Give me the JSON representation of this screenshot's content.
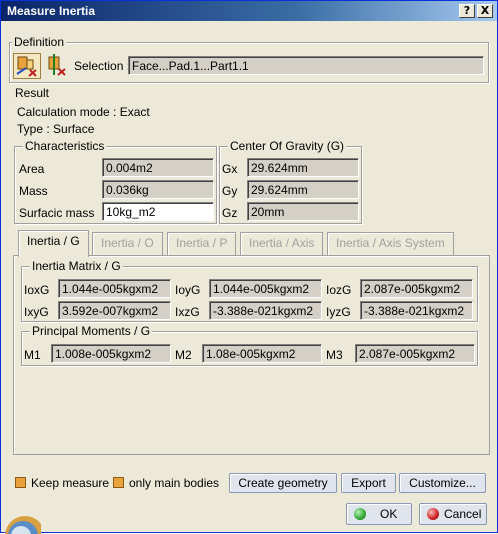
{
  "window": {
    "title": "Measure Inertia",
    "help_glyph": "?",
    "close_glyph": "X"
  },
  "definition": {
    "title": "Definition",
    "selection_label": "Selection :",
    "selection_value": "Face...Pad.1...Part1.1"
  },
  "result": {
    "title": "Result",
    "calc_mode": "Calculation mode :  Exact",
    "type": "Type :  Surface"
  },
  "characteristics": {
    "title": "Characteristics",
    "rows": [
      {
        "label": "Area",
        "value": "0.004m2"
      },
      {
        "label": "Mass",
        "value": "0.036kg"
      },
      {
        "label": "Surfacic mass",
        "value": "10kg_m2"
      }
    ]
  },
  "cog": {
    "title": "Center Of Gravity (G)",
    "rows": [
      {
        "label": "Gx",
        "value": "29.624mm"
      },
      {
        "label": "Gy",
        "value": "29.624mm"
      },
      {
        "label": "Gz",
        "value": "20mm"
      }
    ]
  },
  "tabs": [
    {
      "label": "Inertia / G",
      "active": true
    },
    {
      "label": "Inertia / O",
      "active": false
    },
    {
      "label": "Inertia / P",
      "active": false
    },
    {
      "label": "Inertia / Axis",
      "active": false
    },
    {
      "label": "Inertia / Axis System",
      "active": false
    }
  ],
  "inertia_matrix": {
    "title": "Inertia Matrix / G",
    "cells": [
      {
        "label": "IoxG",
        "value": "1.044e-005kgxm2"
      },
      {
        "label": "IoyG",
        "value": "1.044e-005kgxm2"
      },
      {
        "label": "IozG",
        "value": "2.087e-005kgxm2"
      },
      {
        "label": "IxyG",
        "value": "3.592e-007kgxm2"
      },
      {
        "label": "IxzG",
        "value": "-3.388e-021kgxm2"
      },
      {
        "label": "IyzG",
        "value": "-3.388e-021kgxm2"
      }
    ]
  },
  "principal_moments": {
    "title": "Principal Moments / G",
    "cells": [
      {
        "label": "M1",
        "value": "1.008e-005kgxm2"
      },
      {
        "label": "M2",
        "value": "1.08e-005kgxm2"
      },
      {
        "label": "M3",
        "value": "2.087e-005kgxm2"
      }
    ]
  },
  "options": {
    "keep_measure": "Keep measure",
    "only_main_bodies": "only main bodies"
  },
  "buttons": {
    "create_geometry": "Create geometry",
    "export": "Export",
    "customize": "Customize...",
    "ok": "OK",
    "cancel": "Cancel"
  },
  "colors": {
    "dialog_bg": "#ece9d8",
    "titlebar": "#0a246a",
    "ok_led": "#2fa82f",
    "cancel_led": "#d02020",
    "checkbox": "#e9a23b"
  }
}
